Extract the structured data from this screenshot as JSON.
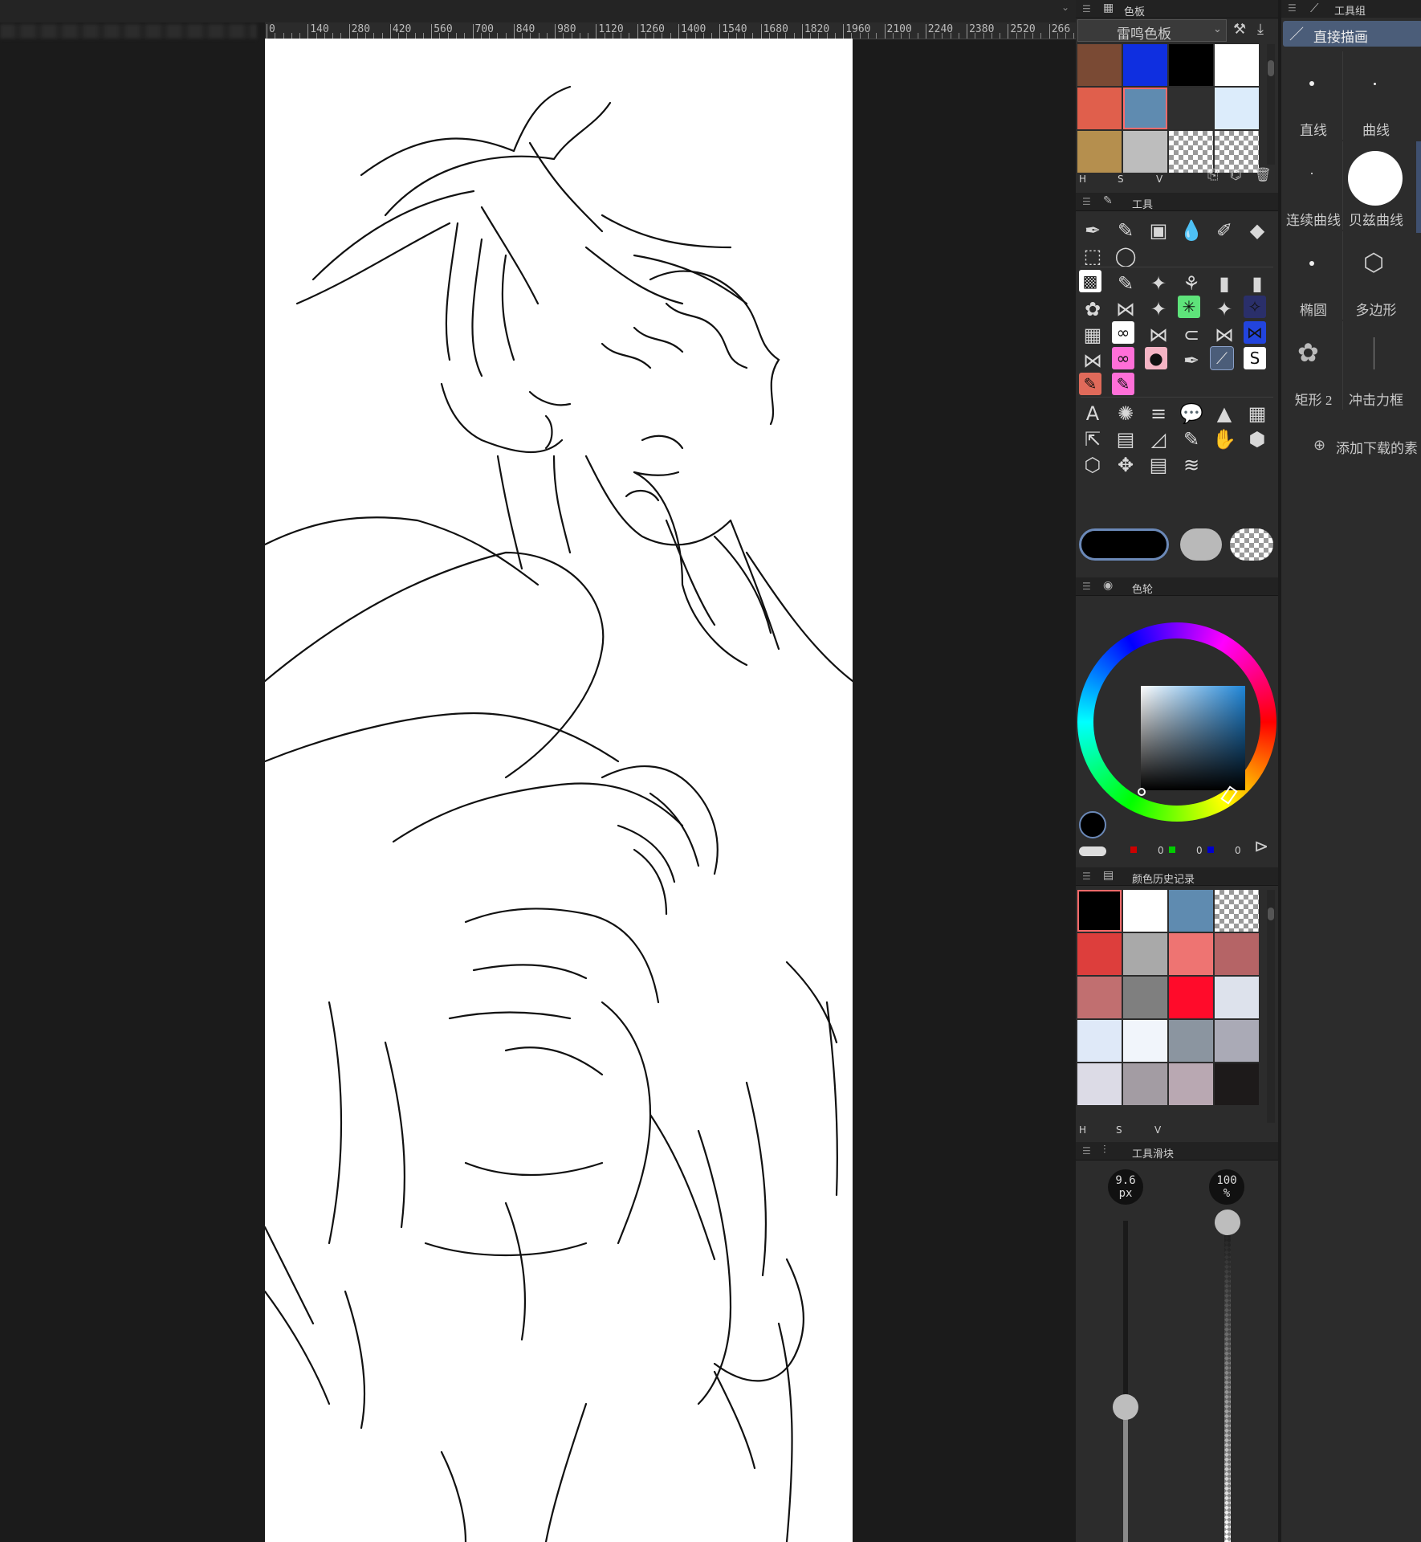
{
  "ruler": {
    "labels": [
      "0",
      "140",
      "280",
      "420",
      "560",
      "700",
      "840",
      "980",
      "1120",
      "1260",
      "1400",
      "1540",
      "1680",
      "1820",
      "1960",
      "2100",
      "2240",
      "2380",
      "2520",
      "266"
    ]
  },
  "color_set": {
    "title": "色板",
    "preset_name": "雷鸣色板",
    "swatches": [
      "#7a4a34",
      "#0f2fe0",
      "#000000",
      "#ffffff",
      "#e05f4c",
      "#5f8bb0",
      "#2f2f2f",
      "#dcecfb",
      "#b58f4e",
      "#bdbdbd",
      "checker",
      "checker"
    ],
    "hsv": [
      "H",
      "S",
      "V"
    ]
  },
  "tools": {
    "title": "工具"
  },
  "wheel": {
    "title": "色轮",
    "rgb": {
      "r": "0",
      "g": "0",
      "b": "0"
    }
  },
  "history": {
    "title": "颜色历史记录",
    "swatches": [
      "#000000",
      "#ffffff",
      "#5f8bb0",
      "checker",
      "#dd3e3c",
      "#a9a9a9",
      "#ee7472",
      "#b56466",
      "#c16f70",
      "#7f7f7f",
      "#ff0b2a",
      "#dde2ec",
      "#dfe9f8",
      "#f1f5fb",
      "#8b95a0",
      "#aaaab6",
      "#dcdbe6",
      "#a39ca3",
      "#b9a8b2",
      "#1d1a1a"
    ],
    "hsv": [
      "H",
      "S",
      "V"
    ]
  },
  "slider": {
    "title": "工具滑块",
    "size_value": "9.6",
    "size_unit": "px",
    "opacity_value": "100",
    "opacity_unit": "%",
    "size_level": 0.1,
    "opacity_level": 1.0
  },
  "tool_group": {
    "title": "工具组",
    "active_tool": "直接描画",
    "items": [
      {
        "label": "直线"
      },
      {
        "label": "曲线"
      },
      {
        "label": "连续曲线"
      },
      {
        "label": "贝兹曲线"
      },
      {
        "label": "椭圆"
      },
      {
        "label": "多边形"
      },
      {
        "label": "矩形 2"
      },
      {
        "label": "冲击力框"
      }
    ],
    "add_label": "添加下载的素"
  }
}
